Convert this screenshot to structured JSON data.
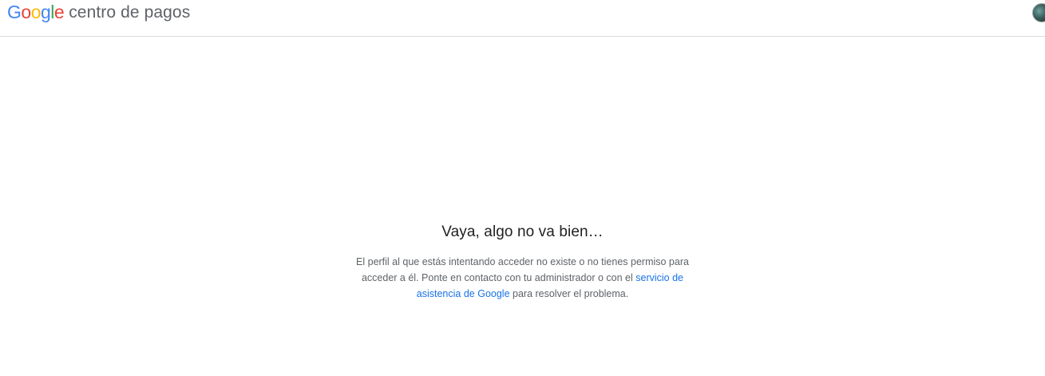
{
  "header": {
    "logo": {
      "letters": [
        "G",
        "o",
        "o",
        "g",
        "l",
        "e"
      ],
      "colors": [
        "#4285F4",
        "#EA4335",
        "#FBBC05",
        "#4285F4",
        "#34A853",
        "#EA4335"
      ]
    },
    "product_name": "centro de pagos",
    "avatar_icon": "account-avatar-icon"
  },
  "main": {
    "title": "Vaya, algo no va bien…",
    "message_before": "El perfil al que estás intentando acceder no existe o no tienes permiso para acceder a él. Ponte en contacto con tu administrador o con el ",
    "support_link": "servicio de asistencia de Google",
    "message_after": " para resolver el problema."
  }
}
